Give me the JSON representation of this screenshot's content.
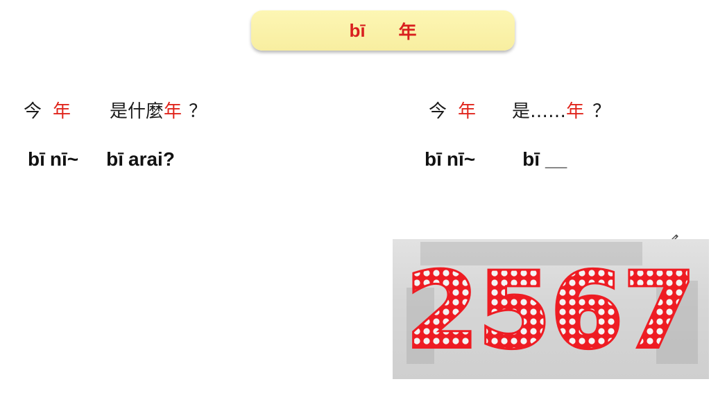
{
  "header": {
    "romanization": "bī",
    "hanzi": "年"
  },
  "left": {
    "line1": {
      "a": "今",
      "b": "年",
      "c": "是什麼",
      "d": "年",
      "e": "？"
    },
    "line2": {
      "a": "bī",
      "b": "nī~",
      "c": "bī",
      "d": "arai?"
    }
  },
  "right": {
    "line1": {
      "a": "今",
      "b": "年",
      "c": "是……",
      "d": "年",
      "e": "？"
    },
    "line2": {
      "a": "bī",
      "b": "nī~",
      "c": "bī",
      "d": "__"
    }
  },
  "image": {
    "number": "2567"
  },
  "colors": {
    "accent_red": "#e0241b",
    "pill_bg": "#fbf2ab"
  },
  "icons": {
    "pen": "pencil-icon"
  }
}
